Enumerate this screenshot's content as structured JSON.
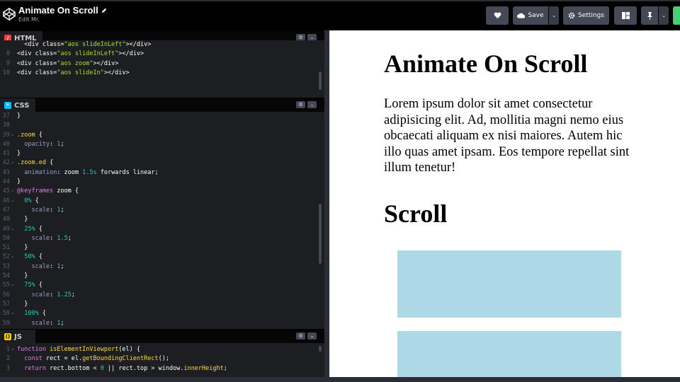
{
  "header": {
    "title": "Animate On Scroll",
    "subtitle": "Edit Mr.",
    "save_label": "Save",
    "settings_label": "Settings",
    "icons": [
      "codepen-logo-icon",
      "pencil-icon",
      "heart-icon",
      "cloud-icon",
      "chevron-down-icon",
      "gear-icon",
      "layout-icon",
      "pin-icon"
    ]
  },
  "panels": {
    "html": {
      "label": "HTML",
      "icon_color": "#ff3c41",
      "lines": [
        {
          "n": "",
          "f": "",
          "c": "  <div class=\"aos slideInLeft\"></div>"
        },
        {
          "n": "8",
          "f": "",
          "c": "<div class=\"aos slideInLeft\"></div>"
        },
        {
          "n": "9",
          "f": "",
          "c": "<div class=\"aos zoom\"></div>"
        },
        {
          "n": "10",
          "f": "",
          "c": "<div class=\"aos slideIn\"></div>"
        }
      ]
    },
    "css": {
      "label": "CSS",
      "icon_color": "#0ebeff",
      "lines": [
        {
          "n": "37",
          "f": "",
          "c": "}"
        },
        {
          "n": "38",
          "f": "",
          "c": ""
        },
        {
          "n": "39",
          "f": "▾",
          "c": ".zoom {"
        },
        {
          "n": "40",
          "f": "",
          "c": "  opacity: 1;"
        },
        {
          "n": "41",
          "f": "",
          "c": "}"
        },
        {
          "n": "42",
          "f": "▾",
          "c": ".zoom.ed {"
        },
        {
          "n": "43",
          "f": "",
          "c": "  animation: zoom 1.5s forwards linear;"
        },
        {
          "n": "44",
          "f": "",
          "c": "}"
        },
        {
          "n": "45",
          "f": "▾",
          "c": "@keyframes zoom {"
        },
        {
          "n": "46",
          "f": "▾",
          "c": "  0% {"
        },
        {
          "n": "47",
          "f": "",
          "c": "    scale: 1;"
        },
        {
          "n": "48",
          "f": "",
          "c": "  }"
        },
        {
          "n": "49",
          "f": "▾",
          "c": "  25% {"
        },
        {
          "n": "50",
          "f": "",
          "c": "    scale: 1.5;"
        },
        {
          "n": "51",
          "f": "",
          "c": "  }"
        },
        {
          "n": "52",
          "f": "▾",
          "c": "  50% {"
        },
        {
          "n": "53",
          "f": "",
          "c": "    scale: 1;"
        },
        {
          "n": "54",
          "f": "",
          "c": "  }"
        },
        {
          "n": "55",
          "f": "▾",
          "c": "  75% {"
        },
        {
          "n": "56",
          "f": "",
          "c": "    scale: 1.25;"
        },
        {
          "n": "57",
          "f": "",
          "c": "  }"
        },
        {
          "n": "58",
          "f": "▾",
          "c": "  100% {"
        },
        {
          "n": "59",
          "f": "",
          "c": "    scale: 1;"
        }
      ]
    },
    "js": {
      "label": "JS",
      "icon_color": "#fcd000",
      "lines": [
        {
          "n": "1",
          "f": "▾",
          "c": "function isElementInViewport(el) {"
        },
        {
          "n": "2",
          "f": "",
          "c": "  const rect = el.getBoundingClientRect();"
        },
        {
          "n": "3",
          "f": "",
          "c": "  return rect.bottom < 0 || rect.top > window.innerHeight;"
        }
      ]
    }
  },
  "preview": {
    "heading": "Animate On Scroll",
    "paragraph": "Lorem ipsum dolor sit amet consectetur adipisicing elit. Ad, mollitia magni nemo eius obcaecati aliquam ex nisi maiores. Autem hic illo quas amet ipsam. Eos tempore repellat sint illum tenetur!",
    "subheading": "Scroll",
    "box_color": "#add8e6"
  }
}
